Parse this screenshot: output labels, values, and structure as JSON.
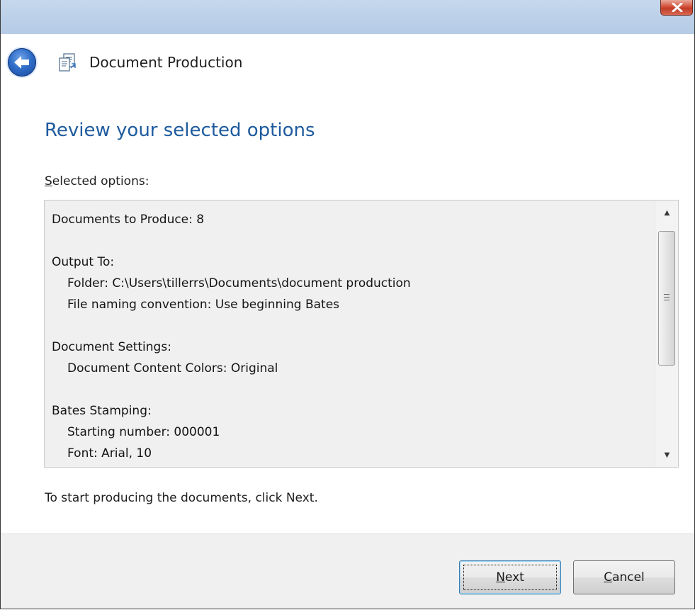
{
  "window": {
    "title": "Document Production",
    "close_label": "x"
  },
  "content": {
    "heading": "Review your selected options",
    "options_label_mnemonic": "S",
    "options_label_rest": "elected options:",
    "options_lines": [
      {
        "text": "Documents to Produce: 8",
        "indent": false
      },
      {
        "text": "",
        "indent": false
      },
      {
        "text": "Output To:",
        "indent": false
      },
      {
        "text": "Folder: C:\\Users\\tillerrs\\Documents\\document production",
        "indent": true
      },
      {
        "text": "File naming convention: Use beginning Bates",
        "indent": true
      },
      {
        "text": "",
        "indent": false
      },
      {
        "text": "Document Settings:",
        "indent": false
      },
      {
        "text": "Document Content Colors: Original",
        "indent": true
      },
      {
        "text": "",
        "indent": false
      },
      {
        "text": "Bates Stamping:",
        "indent": false
      },
      {
        "text": "Starting number: 000001",
        "indent": true
      },
      {
        "text": "Font: Arial, 10",
        "indent": true
      }
    ],
    "scrollbar": {
      "up_arrow": "▲",
      "down_arrow": "▼"
    },
    "instruction": "To start producing the documents, click Next."
  },
  "footer": {
    "next_mnemonic": "N",
    "next_rest": "ext",
    "cancel_mnemonic": "C",
    "cancel_rest": "ancel"
  },
  "icons": {
    "back": "back-arrow-icon",
    "document": "document-production-icon",
    "close": "close-icon",
    "grip": "scroll-grip-icon"
  }
}
